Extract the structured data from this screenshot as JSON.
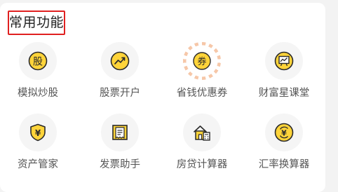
{
  "section": {
    "title": "常用功能"
  },
  "items": [
    {
      "label": "模拟炒股",
      "icon": "stock-coin-icon",
      "glyph": "股"
    },
    {
      "label": "股票开户",
      "icon": "trend-chart-icon"
    },
    {
      "label": "省钱优惠券",
      "icon": "coupon-icon",
      "glyph": "券"
    },
    {
      "label": "财富星课堂",
      "icon": "classroom-board-icon"
    },
    {
      "label": "资产管家",
      "icon": "yuan-shield-icon",
      "glyph": "¥"
    },
    {
      "label": "发票助手",
      "icon": "invoice-receipt-icon"
    },
    {
      "label": "房贷计算器",
      "icon": "house-calculator-icon"
    },
    {
      "label": "汇率换算器",
      "icon": "currency-exchange-icon",
      "glyph": "¥"
    }
  ],
  "colors": {
    "accent_yellow": "#ffd43a",
    "icon_stroke": "#2a2a2a",
    "highlight_border": "#e02020"
  }
}
